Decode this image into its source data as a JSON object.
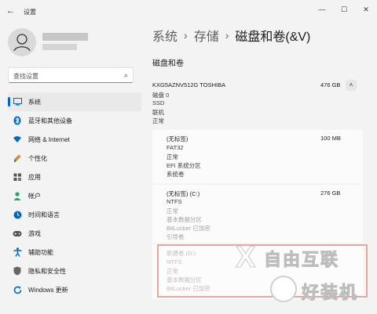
{
  "window": {
    "title": "设置",
    "back_glyph": "←",
    "min_glyph": "—",
    "max_glyph": "☐",
    "close_glyph": "✕"
  },
  "search": {
    "placeholder": "查找设置",
    "icon_glyph": "⌕"
  },
  "sidebar": {
    "items": [
      {
        "label": "系统",
        "icon": "monitor-icon",
        "color": "#0067c0",
        "active": true
      },
      {
        "label": "蓝牙和其他设备",
        "icon": "bluetooth-icon",
        "color": "#0067c0"
      },
      {
        "label": "网络 & Internet",
        "icon": "wifi-icon",
        "color": "#0067c0"
      },
      {
        "label": "个性化",
        "icon": "brush-icon",
        "color": "#d08a3a"
      },
      {
        "label": "应用",
        "icon": "apps-icon",
        "color": "#555555"
      },
      {
        "label": "帐户",
        "icon": "person-icon",
        "color": "#2aa36b"
      },
      {
        "label": "时间和语言",
        "icon": "globe-clock-icon",
        "color": "#0067c0"
      },
      {
        "label": "游戏",
        "icon": "gamepad-icon",
        "color": "#555555"
      },
      {
        "label": "辅助功能",
        "icon": "accessibility-icon",
        "color": "#0067c0"
      },
      {
        "label": "隐私和安全性",
        "icon": "shield-icon",
        "color": "#555555"
      },
      {
        "label": "Windows 更新",
        "icon": "update-icon",
        "color": "#0067c0"
      }
    ]
  },
  "breadcrumb": {
    "part1": "系统",
    "part2": "存储",
    "part3": "磁盘和卷(&V)",
    "sep": "›"
  },
  "main": {
    "section_title": "磁盘和卷",
    "disk": {
      "name": "KXG5AZNV512G TOSHIBA",
      "size": "476 GB",
      "lines": [
        "磁盘 0",
        "SSD",
        "联机",
        "正常"
      ]
    },
    "partitions": [
      {
        "title": "(无标签)",
        "size": "100 MB",
        "lines": [
          "FAT32",
          "正常",
          "EFI 系统分区",
          "系统卷"
        ],
        "faded": false
      },
      {
        "title": "(无标签) (C:)",
        "size": "276 GB",
        "lines": [
          "NTFS",
          "正常",
          "基本数据分区",
          "BitLocker 已加密",
          "引导卷"
        ],
        "faded": true
      },
      {
        "title": "新建卷 (D:)",
        "size": "0 GB",
        "lines": [
          "NTFS",
          "正常",
          "基本数据分区",
          "BitLocker 已加密"
        ],
        "faded": true
      }
    ]
  },
  "watermark": {
    "text1": "自由互联",
    "text2": "好装机"
  }
}
